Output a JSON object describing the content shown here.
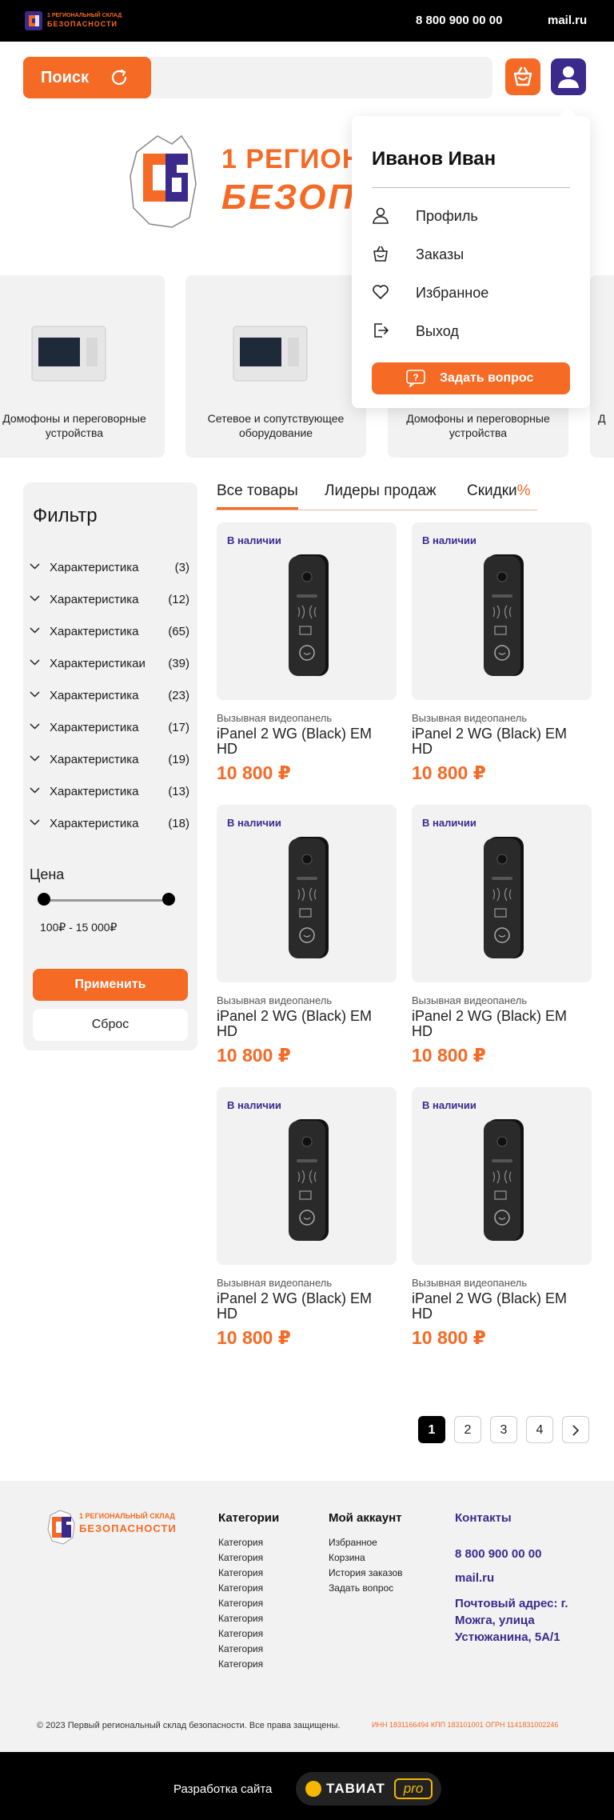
{
  "header": {
    "phone": "8 800 900 00 00",
    "mail": "mail.ru"
  },
  "logo": {
    "line1": "1 РЕГИОНАЛЬНЫЙ СКЛАД",
    "line2": "БЕЗОПАСНОСТИ",
    "mark": "СБ"
  },
  "search": {
    "button_label": "Поиск",
    "placeholder": ""
  },
  "user_menu": {
    "name": "Иванов Иван",
    "items": [
      {
        "label": "Профиль",
        "icon": "user-icon"
      },
      {
        "label": "Заказы",
        "icon": "basket-icon"
      },
      {
        "label": "Избранное",
        "icon": "heart-icon"
      },
      {
        "label": "Выход",
        "icon": "logout-icon"
      }
    ],
    "ask_label": "Задать вопрос"
  },
  "categories": [
    {
      "label": "Домофоны и переговорные устройства"
    },
    {
      "label": "Сетевое и сопутствующее оборудование"
    },
    {
      "label": "Домофоны и переговорные устройства"
    },
    {
      "label": "Д"
    }
  ],
  "filter": {
    "title": "Фильтр",
    "rows": [
      {
        "name": "Характеристика",
        "count": "(3)"
      },
      {
        "name": "Характеристика",
        "count": "(12)"
      },
      {
        "name": "Характеристика",
        "count": "(65)"
      },
      {
        "name": "Характеристикаи",
        "count": "(39)"
      },
      {
        "name": "Характеристика",
        "count": "(23)"
      },
      {
        "name": "Характеристика",
        "count": "(17)"
      },
      {
        "name": "Характеристика",
        "count": "(19)"
      },
      {
        "name": "Характеристика",
        "count": "(13)"
      },
      {
        "name": "Характеристика",
        "count": "(18)"
      }
    ],
    "price_label": "Цена",
    "price_range": "100₽ - 15 000₽",
    "apply_label": "Применить",
    "reset_label": "Сброс"
  },
  "tabs": {
    "all": "Все товары",
    "leaders": "Лидеры продаж",
    "sale": "Скидки",
    "sale_suffix": "%"
  },
  "products": [
    {
      "stock": "В наличии",
      "type": "Вызывная видеопанель",
      "name": "iPanel 2 WG (Black) EM HD",
      "price": "10 800 ₽"
    },
    {
      "stock": "В наличии",
      "type": "Вызывная видеопанель",
      "name": "iPanel 2 WG (Black) EM HD",
      "price": "10 800 ₽"
    },
    {
      "stock": "В наличии",
      "type": "Вызывная видеопанель",
      "name": "iPanel 2 WG (Black) EM HD",
      "price": "10 800 ₽"
    },
    {
      "stock": "В наличии",
      "type": "Вызывная видеопанель",
      "name": "iPanel 2 WG (Black) EM HD",
      "price": "10 800 ₽"
    },
    {
      "stock": "В наличии",
      "type": "Вызывная видеопанель",
      "name": "iPanel 2 WG (Black) EM HD",
      "price": "10 800 ₽"
    },
    {
      "stock": "В наличии",
      "type": "Вызывная видеопанель",
      "name": "iPanel 2 WG (Black) EM HD",
      "price": "10 800 ₽"
    }
  ],
  "pagination": {
    "pages": [
      "1",
      "2",
      "3",
      "4"
    ],
    "current": "1",
    "next": "›"
  },
  "footer": {
    "categories_title": "Категории",
    "categories": [
      "Категория",
      "Категория",
      "Категория",
      "Категория",
      "Категория",
      "Категория",
      "Категория",
      "Категория",
      "Категория"
    ],
    "account_title": "Мой аккаунт",
    "account_links": [
      "Избранное",
      "Корзина",
      "История заказов",
      "Задать вопрос"
    ],
    "contacts_title": "Контакты",
    "phone": "8 800 900 00 00",
    "mail": "mail.ru",
    "address": "Почтовый адрес: г. Можга, улица Устюжанина, 5А/1",
    "copyright": "© 2023 Первый региональный склад безопасности. Все права защищены.",
    "requisites": "ИНН 1831166494 КПП 183101001 ОГРН 1141831002246"
  },
  "developer": {
    "label": "Разработка сайта",
    "brand": "ТАВИАТ",
    "brand_suffix": "pro"
  },
  "colors": {
    "accent": "#f56a25",
    "brand": "#3b2a8c",
    "dark": "#000000",
    "panel": "#f2f2f2"
  }
}
